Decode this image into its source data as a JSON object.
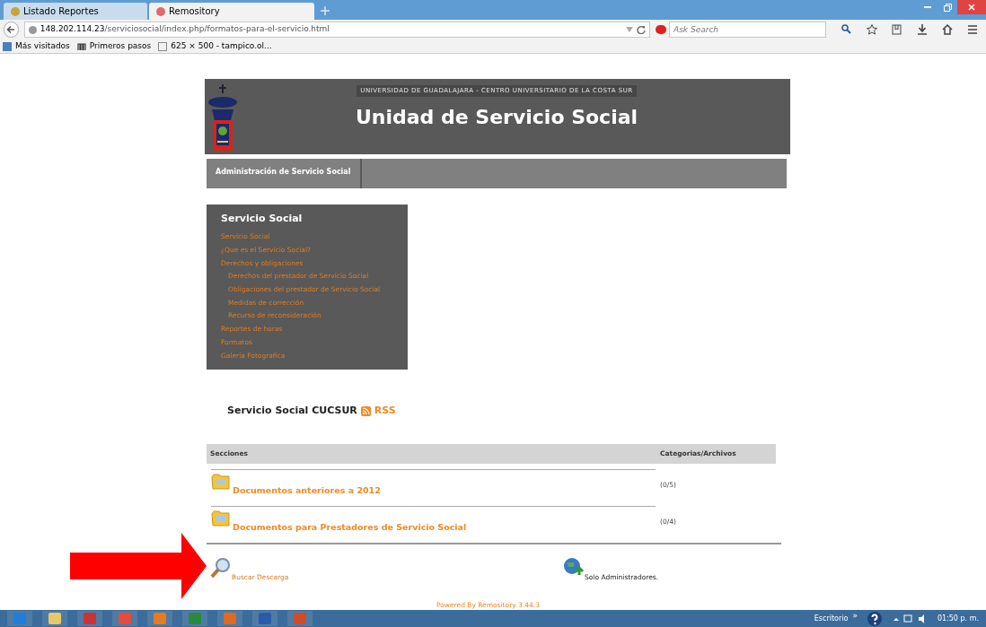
{
  "browser": {
    "tabs": [
      {
        "label": "Listado Reportes",
        "selected": false
      },
      {
        "label": "Remository",
        "selected": true
      }
    ],
    "url": "148.202.114.23/serviciosocial/index.php/formatos-para-el-servicio.html",
    "search": {
      "placeholder": "Ask Search"
    },
    "bookmarks": [
      "Más visitados",
      "Primeros pasos",
      "625 × 500 - tampico.ol..."
    ]
  },
  "header": {
    "subtitle": "UNIVERSIDAD DE GUADALAJARA - CENTRO UNIVERSITARIO DE LA COSTA SUR",
    "title": "Unidad de Servicio Social"
  },
  "nav": {
    "items": [
      "Administración de Servicio Social"
    ]
  },
  "sidebar": {
    "title": "Servicio Social",
    "items": [
      {
        "label": "Servicio Social"
      },
      {
        "label": "¿Que es el Servicio Social?"
      },
      {
        "label": "Derechos y obligaciones",
        "children": [
          {
            "label": "Derechos del prestador de Servicio Social"
          },
          {
            "label": "Obligaciones del prestador de Servicio Social"
          },
          {
            "label": "Medidas de corrección"
          },
          {
            "label": "Recurso de reconsideración"
          }
        ]
      },
      {
        "label": "Reportes de horas"
      },
      {
        "label": "Formatos"
      },
      {
        "label": "Galeria Fotografica"
      }
    ]
  },
  "repository": {
    "title": "Servicio Social CUCSUR",
    "rss": "RSS",
    "columns": [
      "Secciones",
      "Categorias/Archivos"
    ],
    "rows": [
      {
        "name": "Documentos anteriores a 2012",
        "count": "(0/5)"
      },
      {
        "name": "Documentos para Prestadores de Servicio Social",
        "count": "(0/4)"
      }
    ],
    "search_link": "Buscar Descarga",
    "admin_text": "Solo Administradores.",
    "powered": "Powered By Remository 3.44.3"
  },
  "taskbar": {
    "desktop": "Escritorio",
    "chevron": "»",
    "time": "01:50 p. m."
  }
}
